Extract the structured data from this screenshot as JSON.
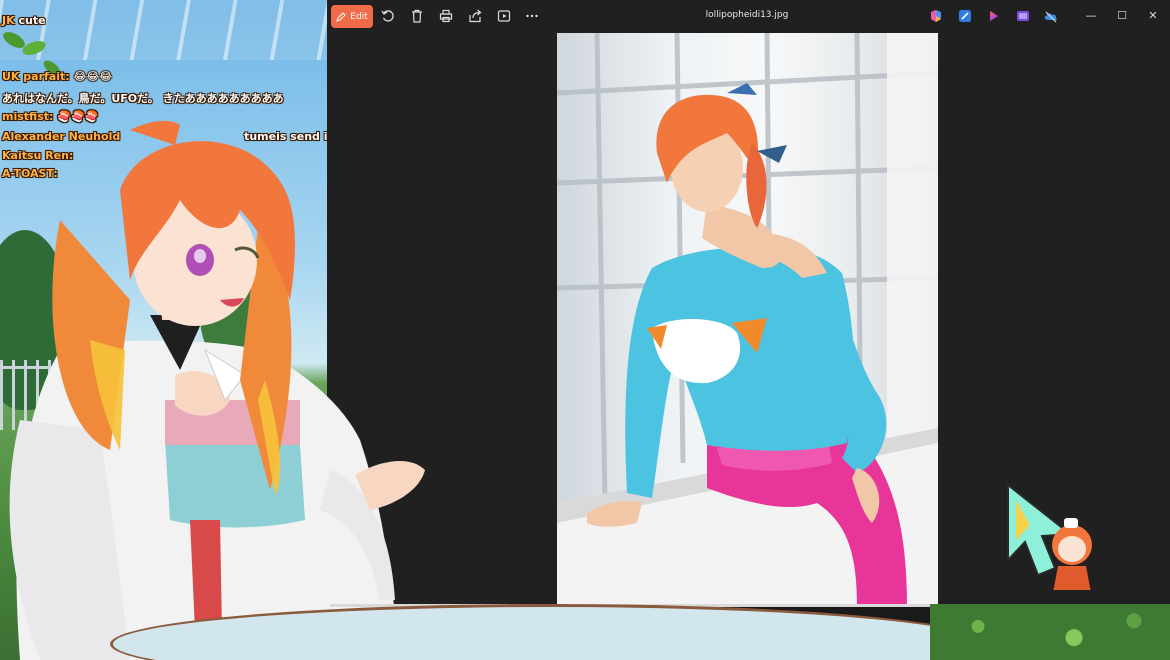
{
  "chat": {
    "lines": [
      {
        "name": "JK",
        "msg": "cute"
      },
      {
        "name": "UK parfait:",
        "msg": "😂😂😂"
      },
      {
        "name": "",
        "msg": "あれはなんだ。鳥だ。UFOだ。 きたあああああああああ"
      },
      {
        "name": "mistfist:",
        "msg": "🍣🍣🍣"
      },
      {
        "name": "Alexander Neuhold",
        "msg": "tumeis send in"
      },
      {
        "name": "Kaitsu Ren:",
        "msg": ""
      },
      {
        "name": "A-TOAST:",
        "msg": ""
      }
    ]
  },
  "photos_app": {
    "edit_label": "Edit",
    "file_title": "lollipopheidi13.jpg",
    "toolbar_icons": [
      "rotate-icon",
      "delete-icon",
      "print-icon",
      "share-icon",
      "slideshow-icon",
      "more-icon"
    ],
    "right_icons": [
      "copilot-icon",
      "designer-icon",
      "clipchamp-icon",
      "photos-app-icon",
      "onedrive-icon"
    ],
    "window_controls": {
      "minimize": "—",
      "maximize": "☐",
      "close": "✕"
    }
  },
  "colors": {
    "edit_accent": "#f06b48",
    "window_bg": "#202020",
    "hair": "#f2773d",
    "sweater": "#4cc3e0",
    "leggings": "#e8359a"
  }
}
